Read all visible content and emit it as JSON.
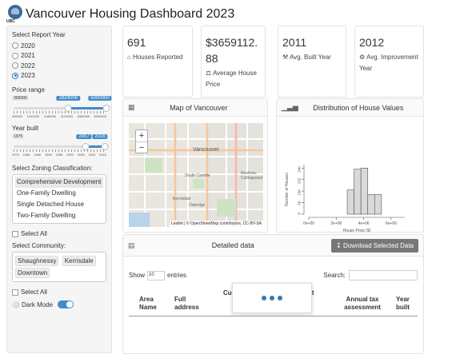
{
  "header": {
    "logo_text": "UBC",
    "title": "Vancouver Housing Dashboard 2023"
  },
  "sidebar": {
    "year_label": "Select Report Year",
    "years": [
      "2020",
      "2021",
      "2022",
      "2023"
    ],
    "selected_year": "2023",
    "price": {
      "label": "Price range",
      "min": "300000",
      "max": "5000000",
      "from": "2824000",
      "to": "5000000",
      "from_fraction": 0.59,
      "to_fraction": 1.0,
      "ticks": [
        "300000",
        "1240000",
        "2180000",
        "3120000",
        "4060000",
        "5000000"
      ]
    },
    "built": {
      "label": "Year built",
      "min": "1975",
      "from": "2007",
      "to": "2016",
      "from_fraction": 0.78,
      "to_fraction": 0.98,
      "ticks": [
        "1975",
        "1980",
        "1985",
        "1990",
        "1995",
        "2000",
        "2005",
        "2010",
        "2015"
      ]
    },
    "zoning_label": "Select Zoning Classification:",
    "zoning_items": [
      "Comprehensive Development",
      "One-Family Dwelling",
      "Single Detached House",
      "Two-Family Dwelling"
    ],
    "select_all_1": "Select All",
    "community_label": "Select Community:",
    "communities": [
      "Shaughnessy",
      "Kerrisdale",
      "Downtown"
    ],
    "select_all_2": "Select All",
    "dark_mode": "Dark Mode"
  },
  "stats": [
    {
      "value": "691",
      "caption": "Houses Reported",
      "icon": "home-icon"
    },
    {
      "value": "$3659112.88",
      "caption": "Average House Price",
      "icon": "balance-icon"
    },
    {
      "value": "2011",
      "caption": "Avg. Built Year",
      "icon": "hammer-icon"
    },
    {
      "value": "2012",
      "caption": "Avg. Improvement Year",
      "icon": "wrench-icon"
    }
  ],
  "map_card": {
    "title": "Map of Vancouver",
    "zoom_in": "+",
    "zoom_out": "−",
    "labels": {
      "city": "Vancouver",
      "south": "South Cambie",
      "kerrisdale": "Kerrisdale",
      "oakridge": "Oakridge",
      "renfrew": "Renfrew-Collingwood"
    },
    "attribution": "Leaflet | © OpenStreetMap contributors, CC-BY-SA"
  },
  "hist_card": {
    "title": "Distribution of House Values"
  },
  "chart_data": {
    "type": "bar",
    "xlabel": "House Price ($)",
    "ylabel": "Number of Houses",
    "x_ticks": [
      "0e+00",
      "2e+06",
      "4e+06",
      "6e+06"
    ],
    "y_ticks": [
      "0",
      "50",
      "100",
      "150",
      "200"
    ],
    "ylim": [
      0,
      215
    ],
    "xlim": [
      0,
      7000000
    ],
    "bins": [
      {
        "from": 2800000,
        "to": 3300000,
        "count": 105
      },
      {
        "from": 3300000,
        "to": 3800000,
        "count": 195
      },
      {
        "from": 3800000,
        "to": 4300000,
        "count": 200
      },
      {
        "from": 4300000,
        "to": 4800000,
        "count": 85
      },
      {
        "from": 4800000,
        "to": 5300000,
        "count": 85
      }
    ]
  },
  "table_card": {
    "title": "Detailed data",
    "download_label": "Download Selected Data",
    "show_label": "Show",
    "length_value": "10",
    "entries_label": "entries",
    "search_label": "Search:",
    "columns": [
      "Area Name",
      "Full address",
      "Cur",
      "t t e",
      "Annual tax assessment",
      "Year built"
    ]
  },
  "colors": {
    "accent": "#337ab7",
    "bar": "#d9d9d9"
  }
}
